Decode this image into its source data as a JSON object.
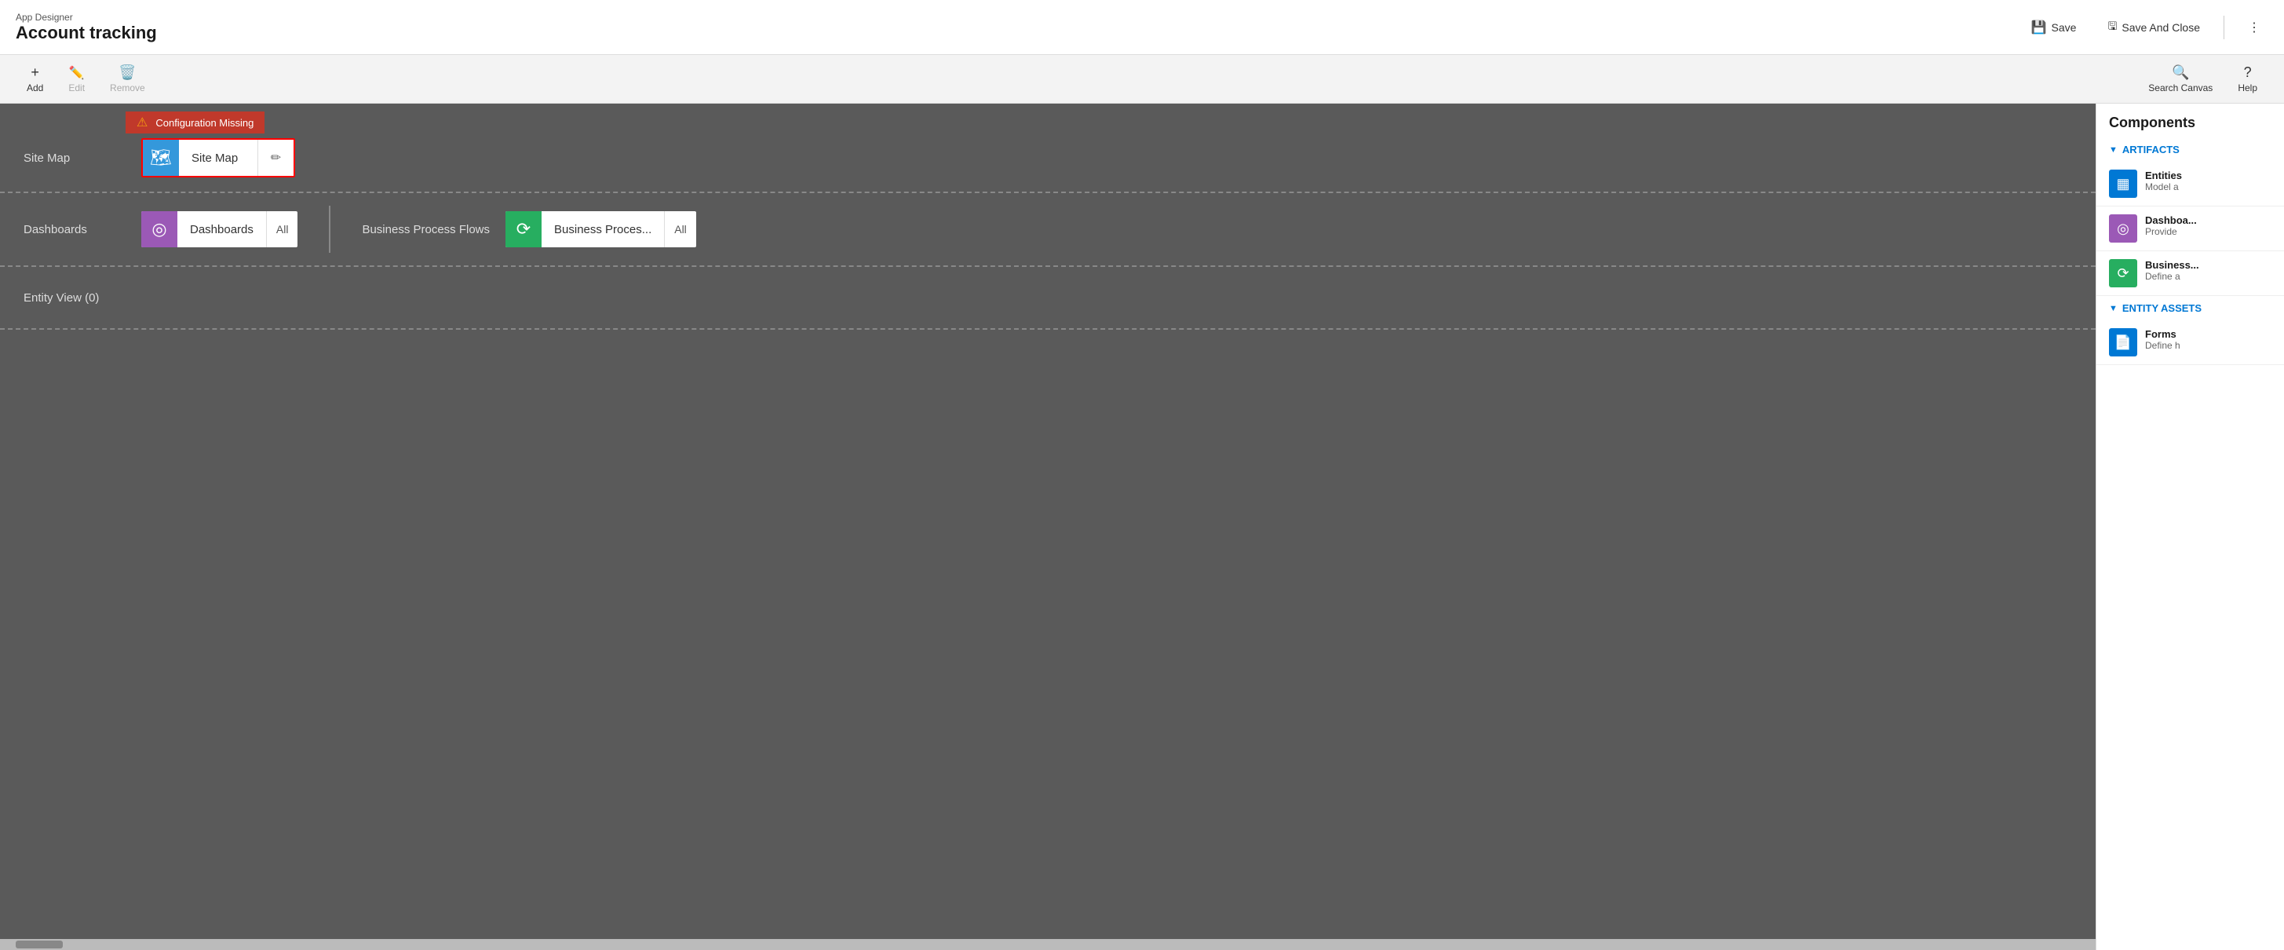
{
  "header": {
    "app_label": "App Designer",
    "app_name": "Account tracking",
    "save_label": "Save",
    "save_close_label": "Save And Close",
    "save_icon": "💾",
    "save_close_icon": "🖫"
  },
  "toolbar": {
    "add_label": "Add",
    "add_icon": "+",
    "edit_label": "Edit",
    "edit_icon": "✏",
    "remove_label": "Remove",
    "remove_icon": "🗑",
    "search_label": "Search Canvas",
    "search_icon": "🔍",
    "help_label": "Help",
    "help_icon": "?"
  },
  "canvas": {
    "site_map_label": "Site Map",
    "config_missing_text": "Configuration Missing",
    "site_map_card_label": "Site Map",
    "dashboards_label": "Dashboards",
    "dashboards_card_label": "Dashboards",
    "dashboards_all": "All",
    "bpf_label": "Business Process Flows",
    "bpf_card_label": "Business Proces...",
    "bpf_all": "All",
    "entity_view_label": "Entity View (0)"
  },
  "right_panel": {
    "title": "Components",
    "artifacts_header": "ARTIFACTS",
    "entity_assets_header": "ENTITY ASSETS",
    "items": [
      {
        "name": "Entities",
        "desc": "Model a",
        "icon_type": "blue",
        "icon": "▦"
      },
      {
        "name": "Dashboa...",
        "desc": "Provide",
        "icon_type": "purple",
        "icon": "◎"
      },
      {
        "name": "Business...",
        "desc": "Define a",
        "icon_type": "green",
        "icon": "⟳"
      }
    ],
    "entity_assets_items": [
      {
        "name": "Forms",
        "desc": "Define h",
        "icon_type": "doc",
        "icon": "📄"
      }
    ]
  }
}
